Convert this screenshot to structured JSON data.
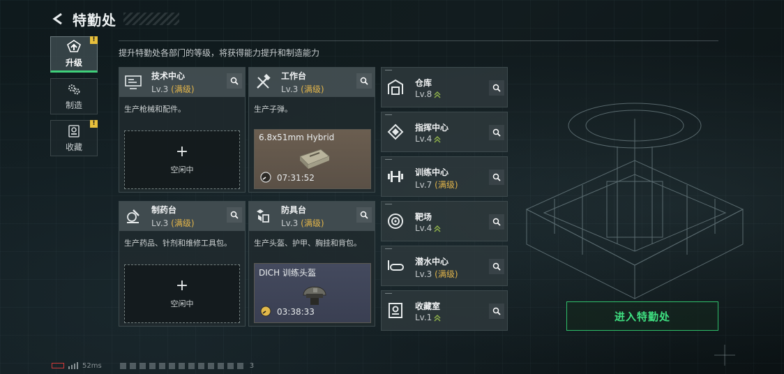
{
  "header": {
    "title": "特勤处",
    "back_icon": "back-arrow-icon"
  },
  "sidenav": [
    {
      "label": "升级",
      "icon": "upgrade-icon",
      "active": true,
      "badge": "!"
    },
    {
      "label": "制造",
      "icon": "gears-icon",
      "active": false,
      "badge": ""
    },
    {
      "label": "收藏",
      "icon": "collection-icon",
      "active": false,
      "badge": "!"
    }
  ],
  "subtitle": "提升特勤处各部门的等级，将获得能力提升和制造能力",
  "cards": [
    {
      "name": "技术中心",
      "level": "Lv.3",
      "max": "(满级)",
      "desc": "生产枪械和配件。",
      "icon": "tech-center-icon",
      "slot": {
        "type": "empty",
        "label": "空闲中",
        "plus": "+"
      }
    },
    {
      "name": "工作台",
      "level": "Lv.3",
      "max": "(满级)",
      "desc": "生产子弹。",
      "icon": "tools-icon",
      "slot": {
        "type": "producing",
        "item": "6.8x51mm Hybrid",
        "timer": "07:31:52",
        "item_icon": "ammo-box-icon"
      }
    },
    {
      "name": "制药台",
      "level": "Lv.3",
      "max": "(满级)",
      "desc": "生产药品、针剂和维修工具包。",
      "icon": "microscope-icon",
      "slot": {
        "type": "empty",
        "label": "空闲中",
        "plus": "+"
      }
    },
    {
      "name": "防具台",
      "level": "Lv.3",
      "max": "(满级)",
      "desc": "生产头盔、护甲、胸挂和背包。",
      "icon": "armor-boxes-icon",
      "slot": {
        "type": "producing",
        "item": "DICH 训练头盔",
        "timer": "03:38:33",
        "item_icon": "helmet-icon"
      }
    }
  ],
  "facilities": [
    {
      "name": "仓库",
      "level": "Lv.8",
      "max": "",
      "upgradable": true,
      "icon": "warehouse-icon"
    },
    {
      "name": "指挥中心",
      "level": "Lv.4",
      "max": "",
      "upgradable": true,
      "icon": "command-center-icon"
    },
    {
      "name": "训练中心",
      "level": "Lv.7",
      "max": "(满级)",
      "upgradable": false,
      "icon": "dumbbell-icon"
    },
    {
      "name": "靶场",
      "level": "Lv.4",
      "max": "",
      "upgradable": true,
      "icon": "target-icon"
    },
    {
      "name": "潜水中心",
      "level": "Lv.3",
      "max": "(满级)",
      "upgradable": false,
      "icon": "diving-mask-icon"
    },
    {
      "name": "收藏室",
      "level": "Lv.1",
      "max": "",
      "upgradable": true,
      "icon": "trophy-room-icon"
    }
  ],
  "enter_button": "进入特勤处",
  "footer": {
    "ping": "52ms",
    "num": "3"
  },
  "colors": {
    "accent_green": "#3fe081",
    "max_gold": "#e3b54a",
    "warning_yellow": "#e8c03c"
  }
}
